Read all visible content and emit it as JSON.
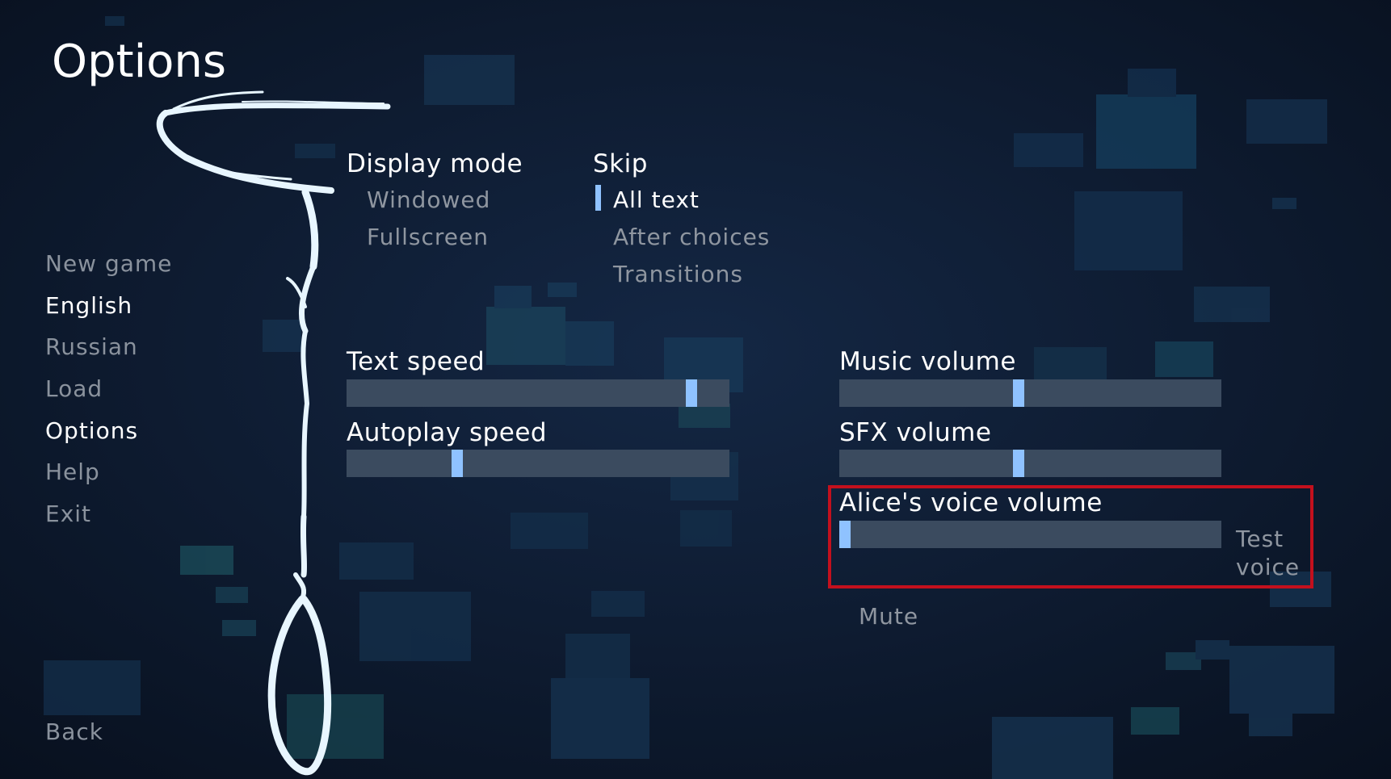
{
  "title": "Options",
  "nav": {
    "new_game": "New game",
    "english": "English",
    "russian": "Russian",
    "load": "Load",
    "options": "Options",
    "help": "Help",
    "exit": "Exit",
    "back": "Back"
  },
  "display_mode": {
    "label": "Display mode",
    "options": [
      "Windowed",
      "Fullscreen"
    ]
  },
  "skip": {
    "label": "Skip",
    "options": [
      "All text",
      "After choices",
      "Transitions"
    ],
    "selected": "All text"
  },
  "sliders": {
    "text_speed": {
      "label": "Text speed",
      "value": 0.9
    },
    "autoplay_speed": {
      "label": "Autoplay speed",
      "value": 0.29
    },
    "music_volume": {
      "label": "Music volume",
      "value": 0.47
    },
    "sfx_volume": {
      "label": "SFX volume",
      "value": 0.47
    },
    "alice_voice_volume": {
      "label": "Alice's voice volume",
      "value": 0.0
    }
  },
  "test_voice": {
    "line1": "Test",
    "line2": "voice"
  },
  "mute": "Mute",
  "colors": {
    "background": "#0c1628",
    "slider_track": "#3b4b5f",
    "slider_thumb": "#8fc2ff",
    "highlight_border": "#c3101d",
    "active_text": "#ffffff",
    "inactive_text": "#8f96a0"
  },
  "icons": {
    "noose": "noose-illustration-icon"
  }
}
